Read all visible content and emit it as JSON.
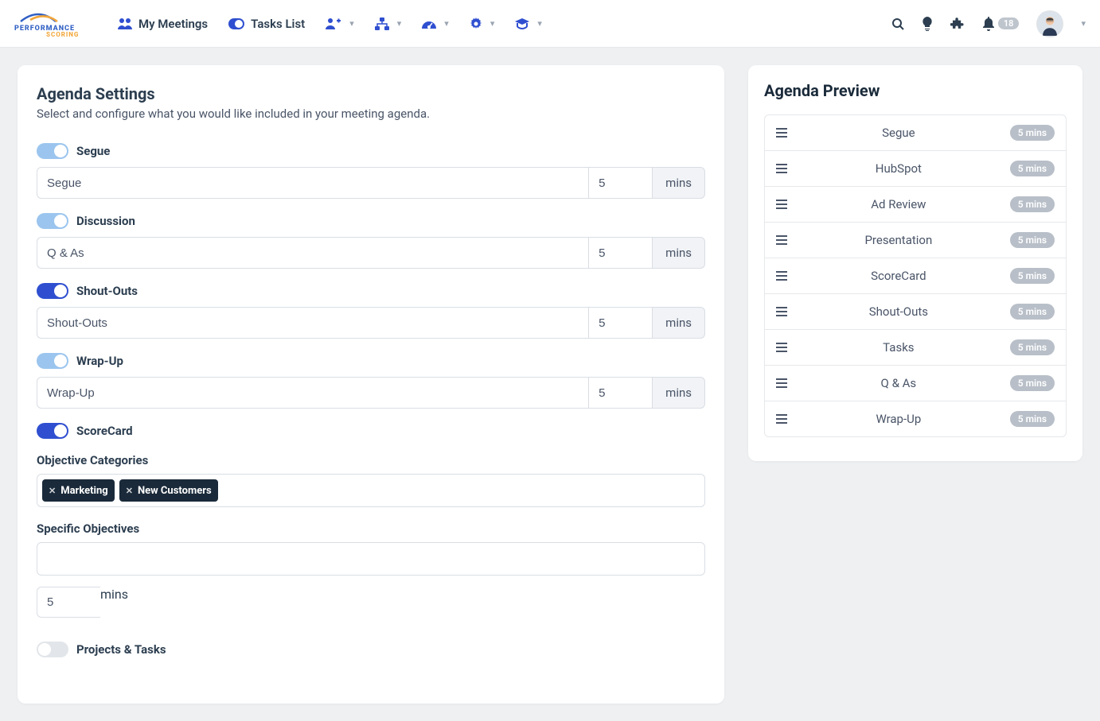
{
  "nav": {
    "my_meetings": "My Meetings",
    "tasks_list": "Tasks List",
    "notif_count": "18"
  },
  "settings": {
    "title": "Agenda Settings",
    "subtitle": "Select and configure what you would like included in your meeting agenda.",
    "mins_unit": "mins",
    "sections": {
      "segue": {
        "label": "Segue",
        "name": "Segue",
        "mins": "5"
      },
      "discussion": {
        "label": "Discussion",
        "name": "Q & As",
        "mins": "5"
      },
      "shoutouts": {
        "label": "Shout-Outs",
        "name": "Shout-Outs",
        "mins": "5"
      },
      "wrapup": {
        "label": "Wrap-Up",
        "name": "Wrap-Up",
        "mins": "5"
      },
      "scorecard": {
        "label": "ScoreCard"
      },
      "projects": {
        "label": "Projects & Tasks"
      }
    },
    "scorecard": {
      "obj_cat_label": "Objective Categories",
      "tags": {
        "t0": "Marketing",
        "t1": "New Customers"
      },
      "spec_obj_label": "Specific Objectives",
      "mins": "5"
    }
  },
  "preview": {
    "title": "Agenda Preview",
    "items": {
      "i0": {
        "name": "Segue",
        "mins": "5 mins"
      },
      "i1": {
        "name": "HubSpot",
        "mins": "5 mins"
      },
      "i2": {
        "name": "Ad Review",
        "mins": "5 mins"
      },
      "i3": {
        "name": "Presentation",
        "mins": "5 mins"
      },
      "i4": {
        "name": "ScoreCard",
        "mins": "5 mins"
      },
      "i5": {
        "name": "Shout-Outs",
        "mins": "5 mins"
      },
      "i6": {
        "name": "Tasks",
        "mins": "5 mins"
      },
      "i7": {
        "name": "Q & As",
        "mins": "5 mins"
      },
      "i8": {
        "name": "Wrap-Up",
        "mins": "5 mins"
      }
    }
  }
}
